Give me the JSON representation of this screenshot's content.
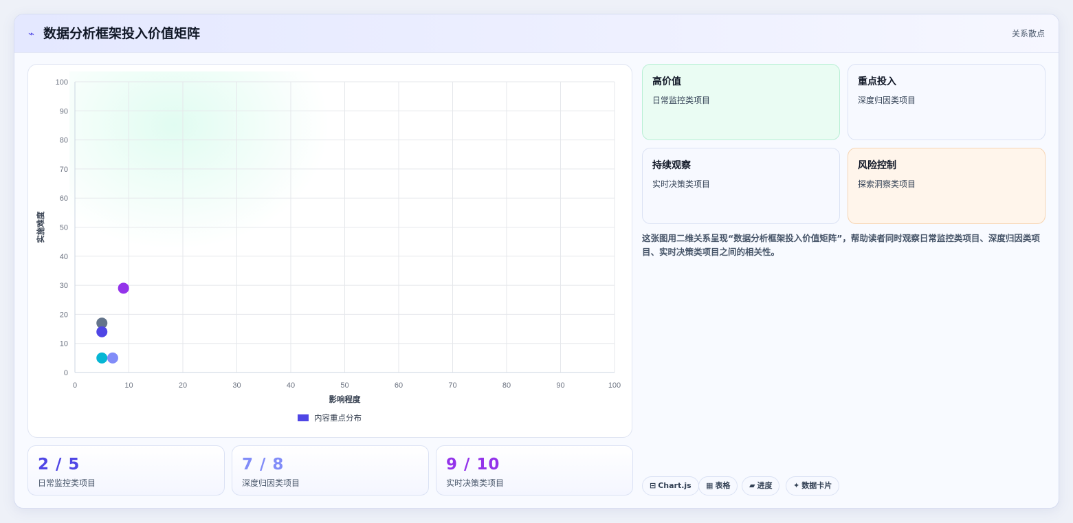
{
  "header": {
    "title": "数据分析框架投入价值矩阵",
    "tag": "关系散点",
    "icon": "bolt-icon"
  },
  "chart_data": {
    "type": "scatter",
    "xlabel": "影响程度",
    "ylabel": "实施难度",
    "xlim": [
      0,
      100
    ],
    "ylim": [
      0,
      100
    ],
    "xticks": [
      0,
      10,
      20,
      30,
      40,
      50,
      60,
      70,
      80,
      90,
      100
    ],
    "yticks": [
      0,
      10,
      20,
      30,
      40,
      50,
      60,
      70,
      80,
      90,
      100
    ],
    "grid": true,
    "legend": {
      "position": "bottom",
      "label": "内容重点分布",
      "color": "#4f46e5"
    },
    "series": [
      {
        "name": "内容重点分布",
        "points": [
          {
            "x": 9,
            "y": 29,
            "color": "#9333ea"
          },
          {
            "x": 5,
            "y": 17,
            "color": "#64748b"
          },
          {
            "x": 5,
            "y": 14,
            "color": "#4f46e5"
          },
          {
            "x": 5,
            "y": 5,
            "color": "#06b6d4"
          },
          {
            "x": 7,
            "y": 5,
            "color": "#818cf8"
          }
        ]
      }
    ]
  },
  "stats": [
    {
      "value": "2 / 5",
      "label": "日常监控类项目",
      "color": "#4f46e5"
    },
    {
      "value": "7 / 8",
      "label": "深度归因类项目",
      "color": "#818cf8"
    },
    {
      "value": "9 / 10",
      "label": "实时决策类项目",
      "color": "#9333ea"
    }
  ],
  "quadrants": [
    {
      "title": "高价值",
      "subtitle": "日常监控类项目"
    },
    {
      "title": "重点投入",
      "subtitle": "深度归因类项目"
    },
    {
      "title": "持续观察",
      "subtitle": "实时决策类项目"
    },
    {
      "title": "风险控制",
      "subtitle": "探索洞察类项目"
    }
  ],
  "description": "这张图用二维关系呈现“数据分析框架投入价值矩阵”，帮助读者同时观察日常监控类项目、深度归因类项目、实时决策类项目之间的相关性。",
  "chips": [
    {
      "icon": "⊟",
      "label": "Chart.js"
    },
    {
      "icon": "▦",
      "label": "表格"
    },
    {
      "icon": "▰",
      "label": "进度"
    },
    {
      "icon": "✦",
      "label": "数据卡片"
    }
  ]
}
